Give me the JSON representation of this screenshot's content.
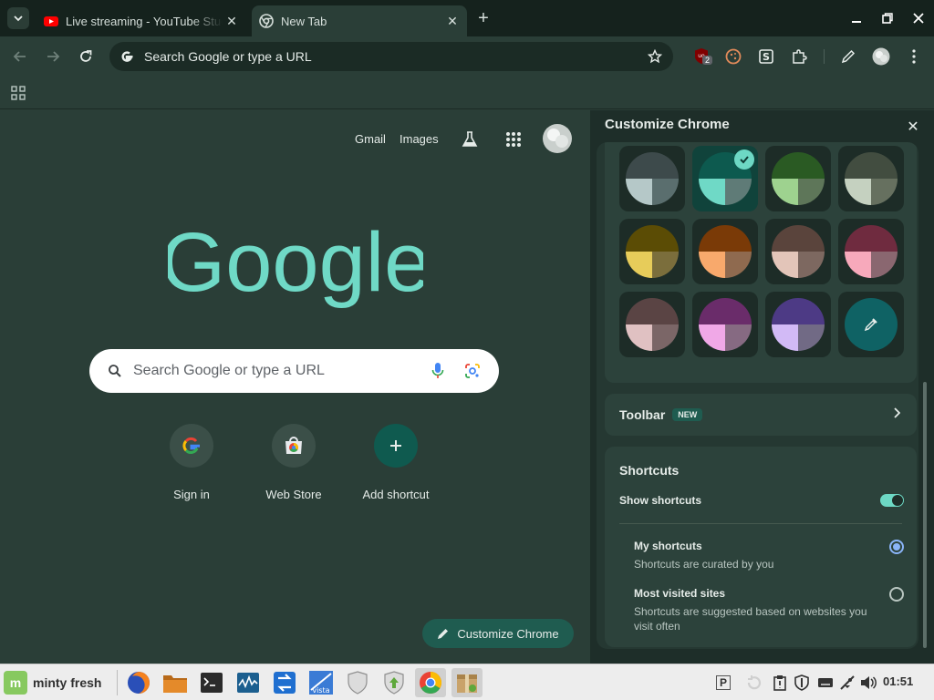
{
  "browser": {
    "tabs": [
      {
        "title": "Live streaming - YouTube Studio",
        "icon": "youtube-icon",
        "active": false
      },
      {
        "title": "New Tab",
        "icon": "chrome-icon",
        "active": true
      }
    ],
    "omnibox_text": "Search Google or type a URL",
    "extension_badge": "2"
  },
  "ntp": {
    "links": {
      "gmail": "Gmail",
      "images": "Images"
    },
    "logo_text": "Google",
    "search_placeholder": "Search Google or type a URL",
    "shortcuts": [
      {
        "label": "Sign in",
        "icon": "google-g-icon"
      },
      {
        "label": "Web Store",
        "icon": "web-store-icon"
      },
      {
        "label": "Add shortcut",
        "icon": "plus-icon"
      }
    ],
    "customize_button": "Customize Chrome"
  },
  "panel": {
    "title": "Customize Chrome",
    "colors": [
      {
        "top": "#3d4a4b",
        "bl": "#b5c8c8",
        "br": "#5a6e6e",
        "selected": false
      },
      {
        "top": "#0d5a4f",
        "bl": "#6fd9c6",
        "br": "#5f7b77",
        "selected": true
      },
      {
        "top": "#2a5a23",
        "bl": "#9ed28f",
        "br": "#5e7659",
        "selected": false
      },
      {
        "top": "#424d40",
        "bl": "#c5d1c0",
        "br": "#66705f",
        "selected": false
      },
      {
        "top": "#5b4c05",
        "bl": "#e7cc5a",
        "br": "#7b6e3c",
        "selected": false
      },
      {
        "top": "#7a3a07",
        "bl": "#f8a96c",
        "br": "#8f6a4f",
        "selected": false
      },
      {
        "top": "#5a443c",
        "bl": "#e3c5b9",
        "br": "#7d6860",
        "selected": false
      },
      {
        "top": "#6f2b3f",
        "bl": "#f7a9bb",
        "br": "#8a6770",
        "selected": false
      },
      {
        "top": "#5a4444",
        "bl": "#e0c1c2",
        "br": "#7b6667",
        "selected": false
      },
      {
        "top": "#6a2c6a",
        "bl": "#f0a8e7",
        "br": "#866a82",
        "selected": false
      },
      {
        "top": "#4d3a85",
        "bl": "#d2baf6",
        "br": "#716a85",
        "selected": false
      }
    ],
    "eyedropper_color": "#0f6264",
    "toolbar_row": {
      "label": "Toolbar",
      "badge": "NEW"
    },
    "shortcuts": {
      "title": "Shortcuts",
      "show_label": "Show shortcuts",
      "show_enabled": true,
      "options": [
        {
          "title": "My shortcuts",
          "desc": "Shortcuts are curated by you",
          "selected": true
        },
        {
          "title": "Most visited sites",
          "desc": "Shortcuts are suggested based on websites you visit often",
          "selected": false
        }
      ]
    }
  },
  "taskbar": {
    "menu_label": "minty fresh",
    "clock": "01:51"
  },
  "colors": {
    "accent": "#6dd8c4",
    "ntp_bg": "#2a3e37",
    "panel_bg": "#1e2e29"
  }
}
